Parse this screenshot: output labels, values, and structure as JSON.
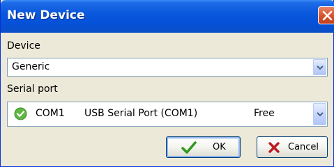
{
  "window": {
    "title": "New Device"
  },
  "device": {
    "label": "Device",
    "value": "Generic"
  },
  "serial_port": {
    "label": "Serial port",
    "port": "COM1",
    "description": "USB Serial Port (COM1)",
    "status": "Free",
    "status_icon": "green-check-circle-icon"
  },
  "buttons": {
    "ok": "OK",
    "cancel": "Cancel"
  },
  "colors": {
    "titlebar": "#0551d8",
    "close": "#d9542f",
    "background": "#ece9d8",
    "check_green": "#5fb741"
  }
}
